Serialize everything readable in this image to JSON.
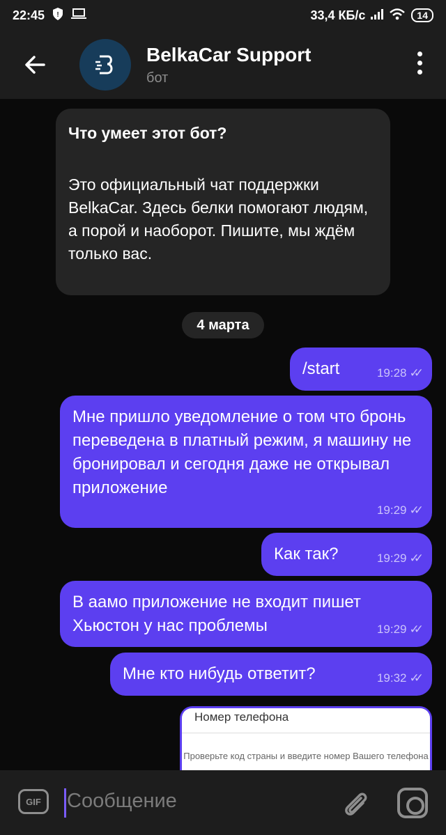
{
  "status": {
    "time": "22:45",
    "speed": "33,4 КБ/с",
    "battery": "14"
  },
  "header": {
    "back_icon": "arrow-left-icon",
    "avatar_letter": "B",
    "title": "BelkaCar Support",
    "subtitle": "бот",
    "menu_icon": "more-vertical-icon"
  },
  "info": {
    "title": "Что умеет этот бот?",
    "text": "Это официальный чат поддержки BelkaCar. Здесь белки помогают людям, а порой и наоборот. Пишите, мы ждём только вас."
  },
  "date": "4 марта",
  "messages": [
    {
      "text": "/start",
      "time": "19:28"
    },
    {
      "text": "Мне пришло уведомление о том что бронь переведена в платный режим, я машину не бронировал и сегодня даже не открывал приложение",
      "time": "19:29"
    },
    {
      "text": "Как так?",
      "time": "19:29"
    },
    {
      "text": "В аамо приложение не входит пишет Хьюстон у нас проблемы",
      "time": "19:29"
    },
    {
      "text": "Мне кто нибудь ответит?",
      "time": "19:32"
    }
  ],
  "photo": {
    "title": "Номер телефона",
    "hint": "Проверьте код страны и введите номер Вашего телефона"
  },
  "input": {
    "gif": "GIF",
    "placeholder": "Сообщение",
    "attach_icon": "paperclip-icon",
    "camera_icon": "camera-icon"
  }
}
